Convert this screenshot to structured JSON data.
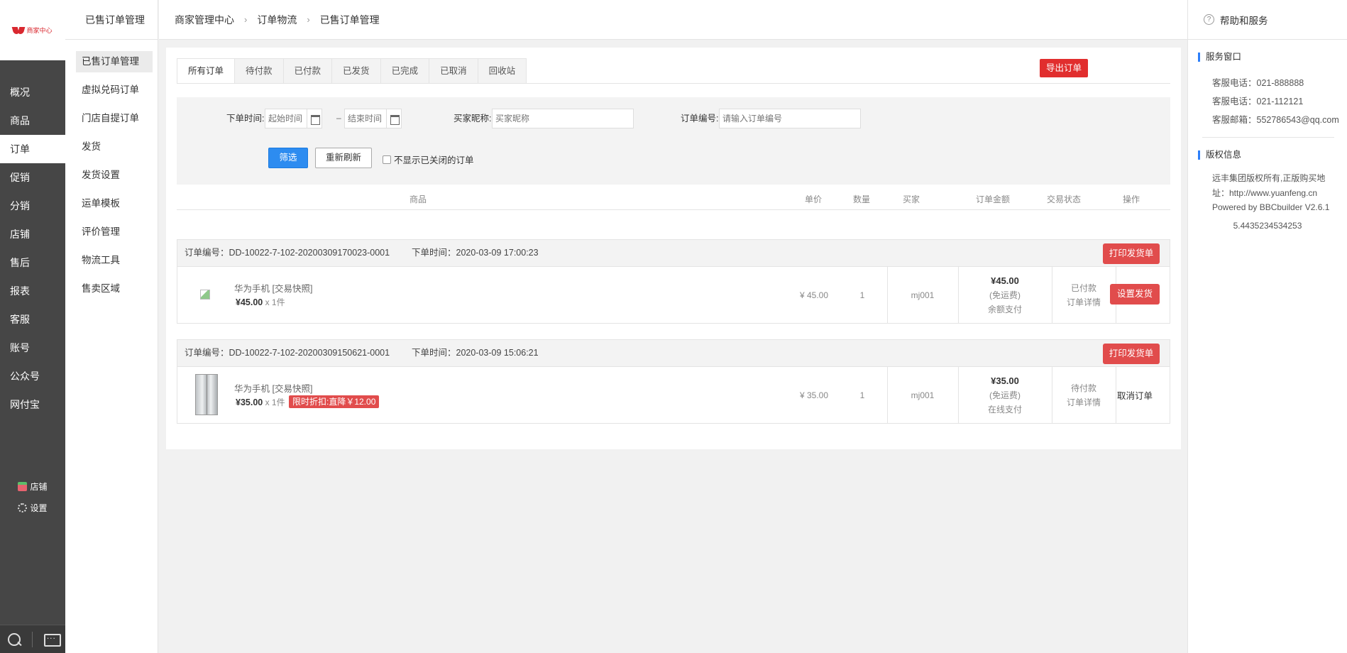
{
  "logo": {
    "text": "商家中心"
  },
  "left_nav": {
    "items": [
      "概况",
      "商品",
      "订单",
      "促销",
      "分销",
      "店铺",
      "售后",
      "报表",
      "客服",
      "账号",
      "公众号",
      "网付宝"
    ],
    "active": "订单",
    "bottom": {
      "shop_label": "店铺",
      "settings_label": "设置"
    }
  },
  "sub_nav": {
    "title": "已售订单管理",
    "items": [
      "已售订单管理",
      "虚拟兑码订单",
      "门店自提订单",
      "发货",
      "发货设置",
      "运单模板",
      "评价管理",
      "物流工具",
      "售卖区域"
    ]
  },
  "breadcrumb": [
    "商家管理中心",
    "订单物流",
    "已售订单管理"
  ],
  "help": {
    "title": "帮助和服务",
    "service_title": "服务窗口",
    "service_lines": [
      "客服电话：021-888888",
      "客服电话：021-112121",
      "客服邮箱：552786543@qq.com"
    ],
    "copyright_title": "版权信息",
    "copyright_lines": [
      "远丰集团版权所有,正版购买地址：http://www.yuanfeng.cn",
      "Powered by BBCbuilder V2.6.1"
    ],
    "number": "5.4435234534253"
  },
  "tabs": [
    "所有订单",
    "待付款",
    "已付款",
    "已发货",
    "已完成",
    "已取消",
    "回收站"
  ],
  "export_label": "导出订单",
  "filter": {
    "order_time_label": "下单时间:",
    "start_placeholder": "起始时间",
    "end_placeholder": "结束时间",
    "dash": "–",
    "buyer_label": "买家昵称:",
    "buyer_placeholder": "买家昵称",
    "order_no_label": "订单编号:",
    "order_no_placeholder": "请输入订单编号",
    "filter_button": "筛选",
    "refresh_button": "重新刷新",
    "hide_closed_label": "不显示已关闭的订单"
  },
  "table_headers": [
    "商品",
    "单价",
    "数量",
    "买家",
    "订单金额",
    "交易状态",
    "操作"
  ],
  "orders": [
    {
      "order_no": "订单编号：DD-10022-7-102-20200309170023-0001",
      "order_time": "下单时间：2020-03-09 17:00:23",
      "print_label": "打印发货单",
      "product_name": "华为手机 [交易快照]",
      "product_price": "¥45.00",
      "product_qty": "x 1件",
      "unit_price": "¥ 45.00",
      "quantity": "1",
      "buyer": "mj001",
      "amount": "¥45.00",
      "shipping": "(免运费)",
      "payment": "余额支付",
      "status": "已付款",
      "detail_link": "订单详情",
      "action": "设置发货"
    },
    {
      "order_no": "订单编号：DD-10022-7-102-20200309150621-0001",
      "order_time": "下单时间：2020-03-09 15:06:21",
      "print_label": "打印发货单",
      "product_name": "华为手机 [交易快照]",
      "product_price": "¥35.00",
      "product_qty": "x 1件",
      "discount_tag": "限时折扣:直降￥12.00",
      "unit_price": "¥ 35.00",
      "quantity": "1",
      "buyer": "mj001",
      "amount": "¥35.00",
      "shipping": "(免运费)",
      "payment": "在线支付",
      "status": "待付款",
      "detail_link": "订单详情",
      "action": "取消订单"
    }
  ]
}
